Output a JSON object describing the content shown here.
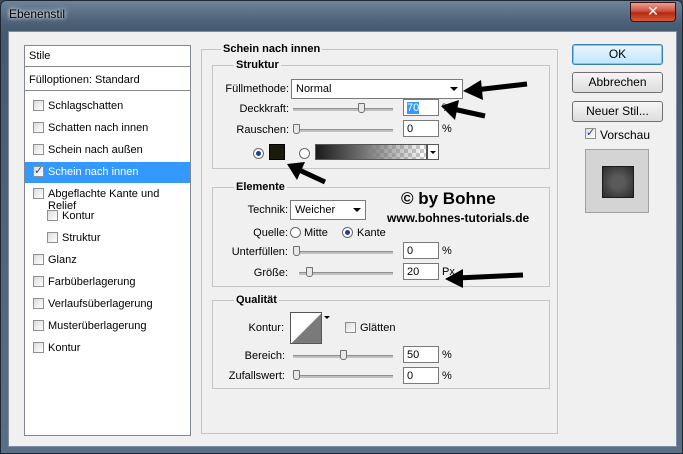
{
  "window": {
    "title": "Ebenenstil",
    "close_glyph": "✕"
  },
  "stylelist": {
    "header": "Stile",
    "fill_options": "Fülloptionen: Standard",
    "items": [
      {
        "label": "Schlagschatten",
        "checked": false,
        "indent": false
      },
      {
        "label": "Schatten nach innen",
        "checked": false,
        "indent": false
      },
      {
        "label": "Schein nach außen",
        "checked": false,
        "indent": false
      },
      {
        "label": "Schein nach innen",
        "checked": true,
        "indent": false,
        "selected": true
      },
      {
        "label": "Abgeflachte Kante und Relief",
        "checked": false,
        "indent": false
      },
      {
        "label": "Kontur",
        "checked": false,
        "indent": true
      },
      {
        "label": "Struktur",
        "checked": false,
        "indent": true
      },
      {
        "label": "Glanz",
        "checked": false,
        "indent": false
      },
      {
        "label": "Farbüberlagerung",
        "checked": false,
        "indent": false
      },
      {
        "label": "Verlaufsüberlagerung",
        "checked": false,
        "indent": false
      },
      {
        "label": "Musterüberlagerung",
        "checked": false,
        "indent": false
      },
      {
        "label": "Kontur",
        "checked": false,
        "indent": false
      }
    ]
  },
  "panel": {
    "title": "Schein nach innen",
    "structure": {
      "title": "Struktur",
      "blend_label": "Füllmethode:",
      "blend_value": "Normal",
      "opacity_label": "Deckkraft:",
      "opacity_value": "70",
      "opacity_unit": "%",
      "opacity_level": 0.7,
      "noise_label": "Rauschen:",
      "noise_value": "0",
      "noise_unit": "%",
      "noise_level": 0,
      "color_fill": "#1a1a08"
    },
    "elements": {
      "title": "Elemente",
      "technique_label": "Technik:",
      "technique_value": "Weicher",
      "source_label": "Quelle:",
      "source_center": "Mitte",
      "source_edge": "Kante",
      "choke_label": "Unterfüllen:",
      "choke_value": "0",
      "choke_unit": "%",
      "choke_level": 0,
      "size_label": "Größe:",
      "size_value": "20",
      "size_unit": "Px",
      "size_level": 0.08
    },
    "quality": {
      "title": "Qualität",
      "contour_label": "Kontur:",
      "antialias_label": "Glätten",
      "range_label": "Bereich:",
      "range_value": "50",
      "range_unit": "%",
      "range_level": 0.5,
      "jitter_label": "Zufallswert:",
      "jitter_value": "0",
      "jitter_unit": "%",
      "jitter_level": 0
    }
  },
  "watermark": {
    "line1": "© by Bohne",
    "line2": "www.bohnes-tutorials.de"
  },
  "buttons": {
    "ok": "OK",
    "cancel": "Abbrechen",
    "new_style": "Neuer Stil...",
    "preview_label": "Vorschau"
  }
}
